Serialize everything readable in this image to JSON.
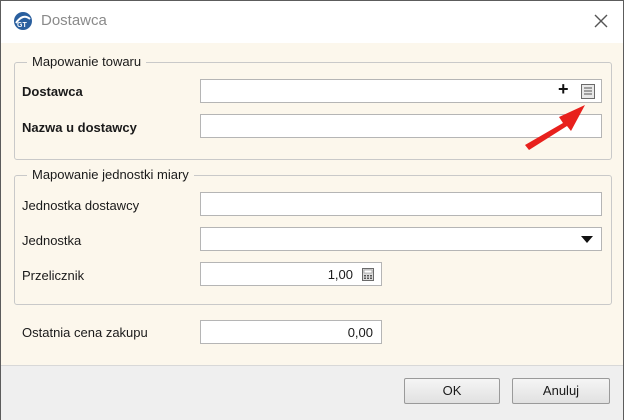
{
  "window": {
    "title": "Dostawca"
  },
  "group_towar": {
    "legend": "Mapowanie towaru",
    "dostawca_label": "Dostawca",
    "dostawca_value": "",
    "nazwa_label": "Nazwa u dostawcy",
    "nazwa_value": "",
    "plus_icon": "+"
  },
  "group_jednostka": {
    "legend": "Mapowanie jednostki miary",
    "jednostka_dostawcy_label": "Jednostka dostawcy",
    "jednostka_dostawcy_value": "",
    "jednostka_label": "Jednostka",
    "jednostka_value": "",
    "przelicznik_label": "Przelicznik",
    "przelicznik_value": "1,00"
  },
  "ostatnia": {
    "label": "Ostatnia cena zakupu",
    "value": "0,00"
  },
  "buttons": {
    "ok": "OK",
    "cancel": "Anuluj"
  },
  "colors": {
    "accent_arrow": "#e8201c",
    "dialog_bg": "#fcf7ec"
  }
}
